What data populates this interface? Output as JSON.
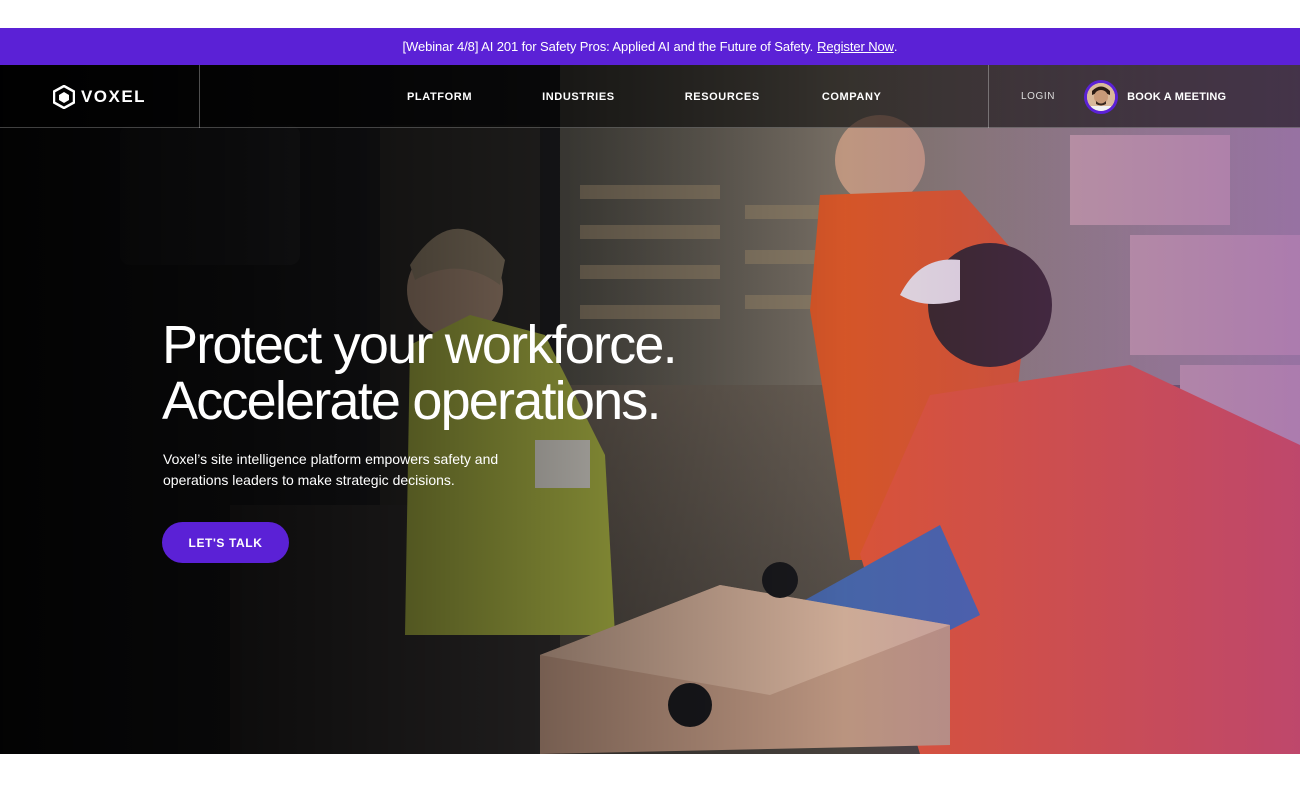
{
  "banner": {
    "text": "[Webinar 4/8] AI 201 for Safety Pros: Applied AI and the Future of Safety.",
    "link_label": "Register Now",
    "trailing": "."
  },
  "nav": {
    "logo_text": "VOXEL",
    "links": [
      "PLATFORM",
      "INDUSTRIES",
      "RESOURCES",
      "COMPANY"
    ],
    "login_label": "LOGIN",
    "book_label": "BOOK A MEETING"
  },
  "hero": {
    "headline_line1": "Protect your workforce.",
    "headline_line2": "Accelerate operations.",
    "subcopy": "Voxel’s site intelligence platform empowers safety and operations leaders to make strategic decisions.",
    "cta_label": "LET'S TALK"
  },
  "colors": {
    "brand_purple": "#5b21d6",
    "nav_bg": "rgba(0,0,0,0.55)",
    "text": "#ffffff"
  },
  "icons": [
    "voxel-logo-hex-icon",
    "avatar-photo"
  ]
}
